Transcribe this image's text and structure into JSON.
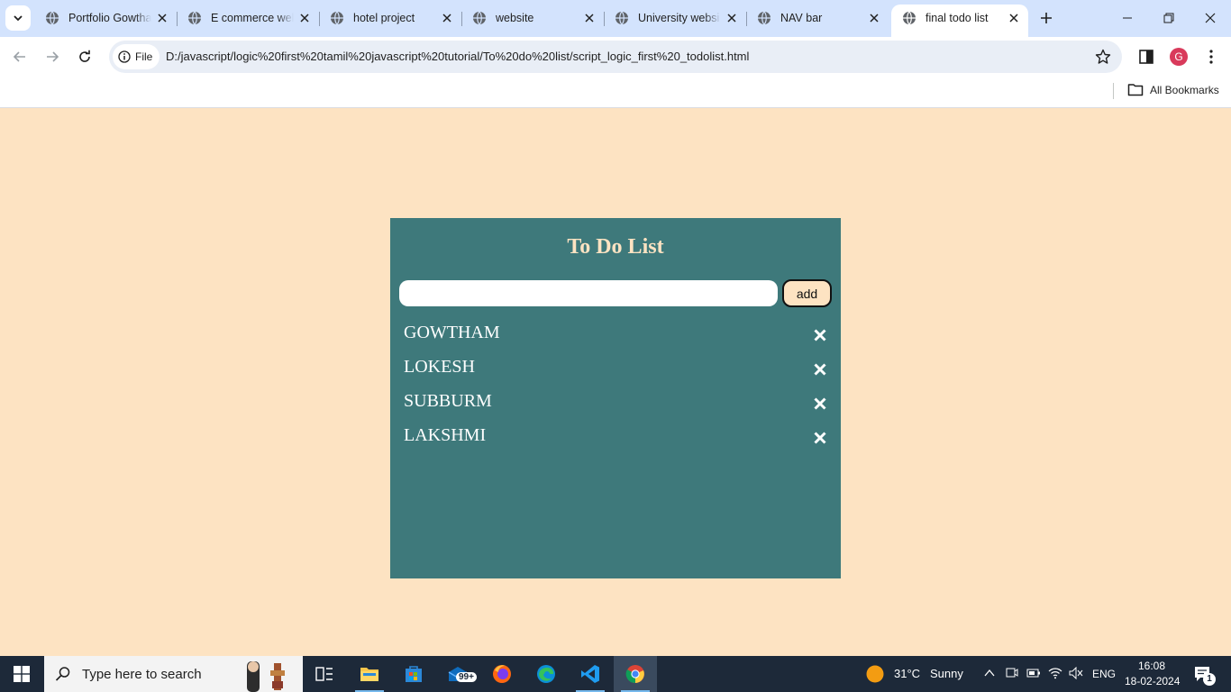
{
  "browser": {
    "tabs": [
      {
        "title": "Portfolio Gowtha"
      },
      {
        "title": "E commerce wel"
      },
      {
        "title": "hotel project"
      },
      {
        "title": "website"
      },
      {
        "title": "University websi"
      },
      {
        "title": "NAV bar"
      },
      {
        "title": "final todo list",
        "active": true
      }
    ],
    "address": {
      "chip_label": "File",
      "url": "D:/javascript/logic%20first%20tamil%20javascript%20tutorial/To%20do%20list/script_logic_first%20_todolist.html"
    },
    "profile_initial": "G",
    "bookmarks": {
      "all_label": "All Bookmarks"
    }
  },
  "todo": {
    "heading": "To Do List",
    "input": {
      "value": "",
      "placeholder": ""
    },
    "add_label": "add",
    "items": [
      "GOWTHAM",
      "LOKESH",
      "SUBBURM",
      "LAKSHMI"
    ]
  },
  "taskbar": {
    "search_placeholder": "Type here to search",
    "mail_badge": "99+",
    "weather": {
      "temp": "31°C",
      "condition": "Sunny"
    },
    "language": "ENG",
    "time": "16:08",
    "date": "18-02-2024",
    "notification_count": "1"
  },
  "colors": {
    "page_bg": "#fde3c2",
    "card_bg": "#3e797b",
    "heading": "#fde3c2",
    "add_button_bg": "#fde3c2"
  }
}
